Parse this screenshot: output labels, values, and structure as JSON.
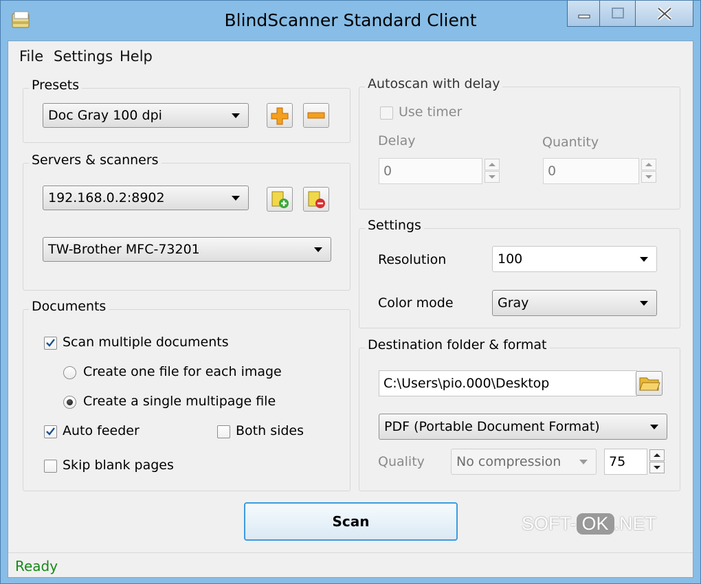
{
  "window": {
    "title": "BlindScanner Standard Client"
  },
  "menu": {
    "file": "File",
    "settings": "Settings",
    "help": "Help"
  },
  "presets": {
    "legend": "Presets",
    "selected": "Doc Gray 100 dpi"
  },
  "servers": {
    "legend": "Servers & scanners",
    "server": "192.168.0.2:8902",
    "scanner": "TW-Brother MFC-73201"
  },
  "documents": {
    "legend": "Documents",
    "scan_multiple": {
      "label": "Scan multiple documents",
      "checked": true
    },
    "one_file_each": {
      "label": "Create one file for each image",
      "selected": false
    },
    "single_multipage": {
      "label": "Create a single multipage file",
      "selected": true
    },
    "auto_feeder": {
      "label": "Auto feeder",
      "checked": true
    },
    "both_sides": {
      "label": "Both sides",
      "checked": false
    },
    "skip_blank": {
      "label": "Skip blank pages",
      "checked": false
    }
  },
  "autoscan": {
    "legend": "Autoscan with delay",
    "use_timer": {
      "label": "Use timer",
      "checked": false
    },
    "delay_label": "Delay",
    "delay_value": "0",
    "quantity_label": "Quantity",
    "quantity_value": "0"
  },
  "settings": {
    "legend": "Settings",
    "resolution_label": "Resolution",
    "resolution_value": "100",
    "color_mode_label": "Color mode",
    "color_mode_value": "Gray"
  },
  "destination": {
    "legend": "Destination folder & format",
    "path": "C:\\Users\\pio.000\\Desktop",
    "format": "PDF (Portable Document Format)",
    "quality_label": "Quality",
    "compression": "No compression",
    "quality_value": "75"
  },
  "scan_button": "Scan",
  "status": "Ready",
  "watermark": {
    "left": "SOFT-",
    "middle": "OK",
    "right": ".NET"
  }
}
